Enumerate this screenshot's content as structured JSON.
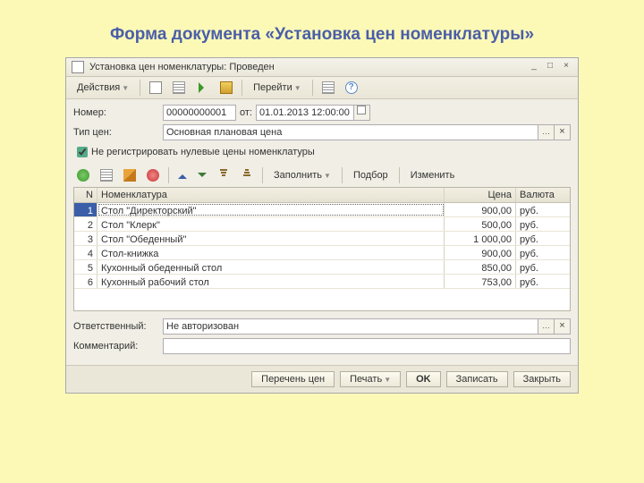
{
  "page_heading": "Форма документа «Установка цен номенклатуры»",
  "window": {
    "title": "Установка цен номенклатуры: Проведен",
    "min": "_",
    "max": "□",
    "close": "×"
  },
  "toolbar": {
    "actions": "Действия",
    "goto": "Перейти"
  },
  "form": {
    "number_label": "Номер:",
    "number_value": "00000000001",
    "from_label": "от:",
    "date_value": "01.01.2013 12:00:00",
    "price_type_label": "Тип цен:",
    "price_type_value": "Основная плановая цена",
    "no_zero_label": "Не регистрировать нулевые цены номенклатуры",
    "responsible_label": "Ответственный:",
    "responsible_value": "Не авторизован",
    "comment_label": "Комментарий:",
    "comment_value": ""
  },
  "subtoolbar": {
    "fill": "Заполнить",
    "select": "Подбор",
    "change": "Изменить"
  },
  "table": {
    "headers": {
      "n": "N",
      "name": "Номенклатура",
      "price": "Цена",
      "cur": "Валюта"
    },
    "rows": [
      {
        "n": "1",
        "name": "Стол \"Директорский\"",
        "price": "900,00",
        "cur": "руб."
      },
      {
        "n": "2",
        "name": "Стол \"Клерк\"",
        "price": "500,00",
        "cur": "руб."
      },
      {
        "n": "3",
        "name": "Стол \"Обеденный\"",
        "price": "1 000,00",
        "cur": "руб."
      },
      {
        "n": "4",
        "name": "Стол-книжка",
        "price": "900,00",
        "cur": "руб."
      },
      {
        "n": "5",
        "name": "Кухонный обеденный стол",
        "price": "850,00",
        "cur": "руб."
      },
      {
        "n": "6",
        "name": "Кухонный рабочий стол",
        "price": "753,00",
        "cur": "руб."
      }
    ]
  },
  "footer": {
    "price_list": "Перечень цен",
    "print": "Печать",
    "ok": "OK",
    "save": "Записать",
    "close": "Закрыть"
  }
}
